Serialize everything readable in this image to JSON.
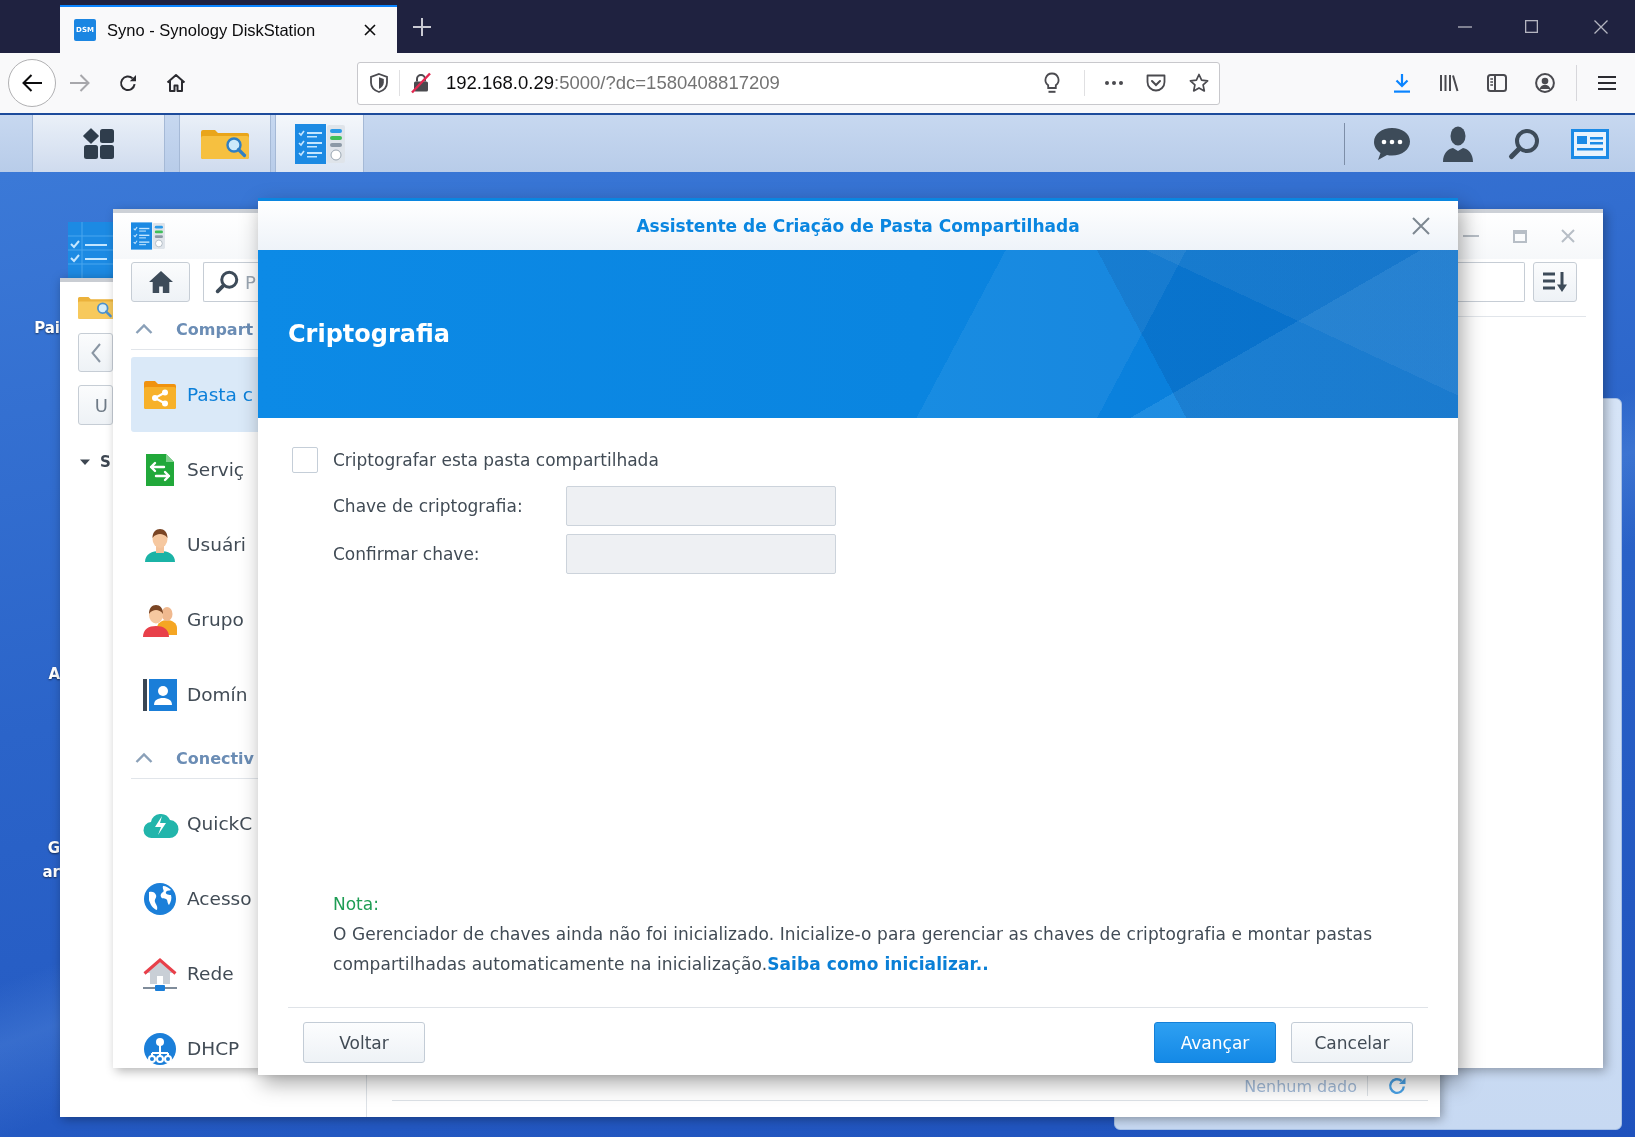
{
  "browser": {
    "tab": {
      "favicon_text": "DSM",
      "title": "Syno - Synology DiskStation",
      "selected": true
    },
    "address": {
      "host": "192.168.0.29",
      "path": ":5000/?dc=1580408817209"
    }
  },
  "desktop": {
    "icon_labels": [
      "Pai",
      "A",
      "G ar"
    ]
  },
  "file_station": {
    "button_label": "U",
    "tree": [
      {
        "label": "S",
        "expanded": true
      }
    ],
    "status": "Nenhum dado"
  },
  "control_panel": {
    "search": {
      "placeholder": "P"
    },
    "sections": [
      {
        "title": "Compart",
        "expanded": true,
        "items": [
          {
            "label": "Pasta c",
            "selected": true
          },
          {
            "label": "Serviç",
            "selected": false
          },
          {
            "label": "Usuári",
            "selected": false
          },
          {
            "label": "Grupo",
            "selected": false
          },
          {
            "label": "Domín",
            "selected": false
          }
        ]
      },
      {
        "title": "Conectiv",
        "expanded": true,
        "items": [
          {
            "label": "QuickC",
            "selected": false
          },
          {
            "label": "Acesso",
            "selected": false
          },
          {
            "label": "Rede",
            "selected": false
          },
          {
            "label": "DHCP",
            "selected": false
          }
        ]
      }
    ]
  },
  "dialog": {
    "title": "Assistente de Criação de Pasta Compartilhada",
    "step_title": "Criptografia",
    "option": {
      "label": "Criptografar esta pasta compartilhada",
      "checked": false
    },
    "fields": [
      {
        "label": "Chave de criptografia:",
        "disabled": true
      },
      {
        "label": "Confirmar chave:",
        "disabled": true
      }
    ],
    "note": {
      "heading": "Nota:",
      "text": "O Gerenciador de chaves ainda não foi inicializado. Inicialize-o para gerenciar as chaves de criptografia e montar pastas compartilhadas automaticamente na inicialização.",
      "link": "Saiba como inicializar.."
    },
    "buttons": [
      {
        "label": "Voltar",
        "kind": "default"
      },
      {
        "label": "Avançar",
        "kind": "primary"
      },
      {
        "label": "Cancelar",
        "kind": "default"
      }
    ]
  }
}
